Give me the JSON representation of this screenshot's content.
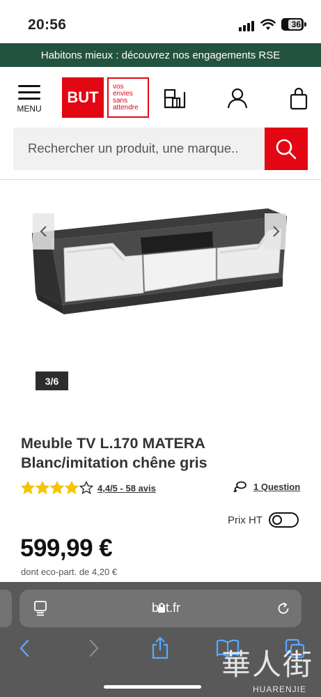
{
  "status_bar": {
    "time": "20:56",
    "battery": "36"
  },
  "banner": {
    "text": "Habitons mieux : découvrez nos engagements RSE"
  },
  "header": {
    "menu_label": "MENU",
    "logo_text": "BUT",
    "logo_tagline": [
      "vos",
      "envies",
      "sans",
      "attendre"
    ]
  },
  "search": {
    "placeholder": "Rechercher un produit, une marque.."
  },
  "gallery": {
    "counter": "3/6"
  },
  "product": {
    "title_line1": "Meuble TV L.170 MATERA",
    "title_line2": "Blanc/imitation chêne gris",
    "rating_value": 4.4,
    "rating_text": "4,4/5 - 58 avis",
    "question_text": "1 Question",
    "prix_ht_label": "Prix HT",
    "prix_ht_enabled": false,
    "price": "599,99 €",
    "eco_part": "dont eco-part. de 4,20 €"
  },
  "browser": {
    "url": "but.fr"
  },
  "watermark": {
    "cn": "華人街",
    "en": "HUARENJIE"
  },
  "colors": {
    "brand_red": "#e30613",
    "banner_green": "#23533e",
    "star_yellow": "#f5c400"
  }
}
